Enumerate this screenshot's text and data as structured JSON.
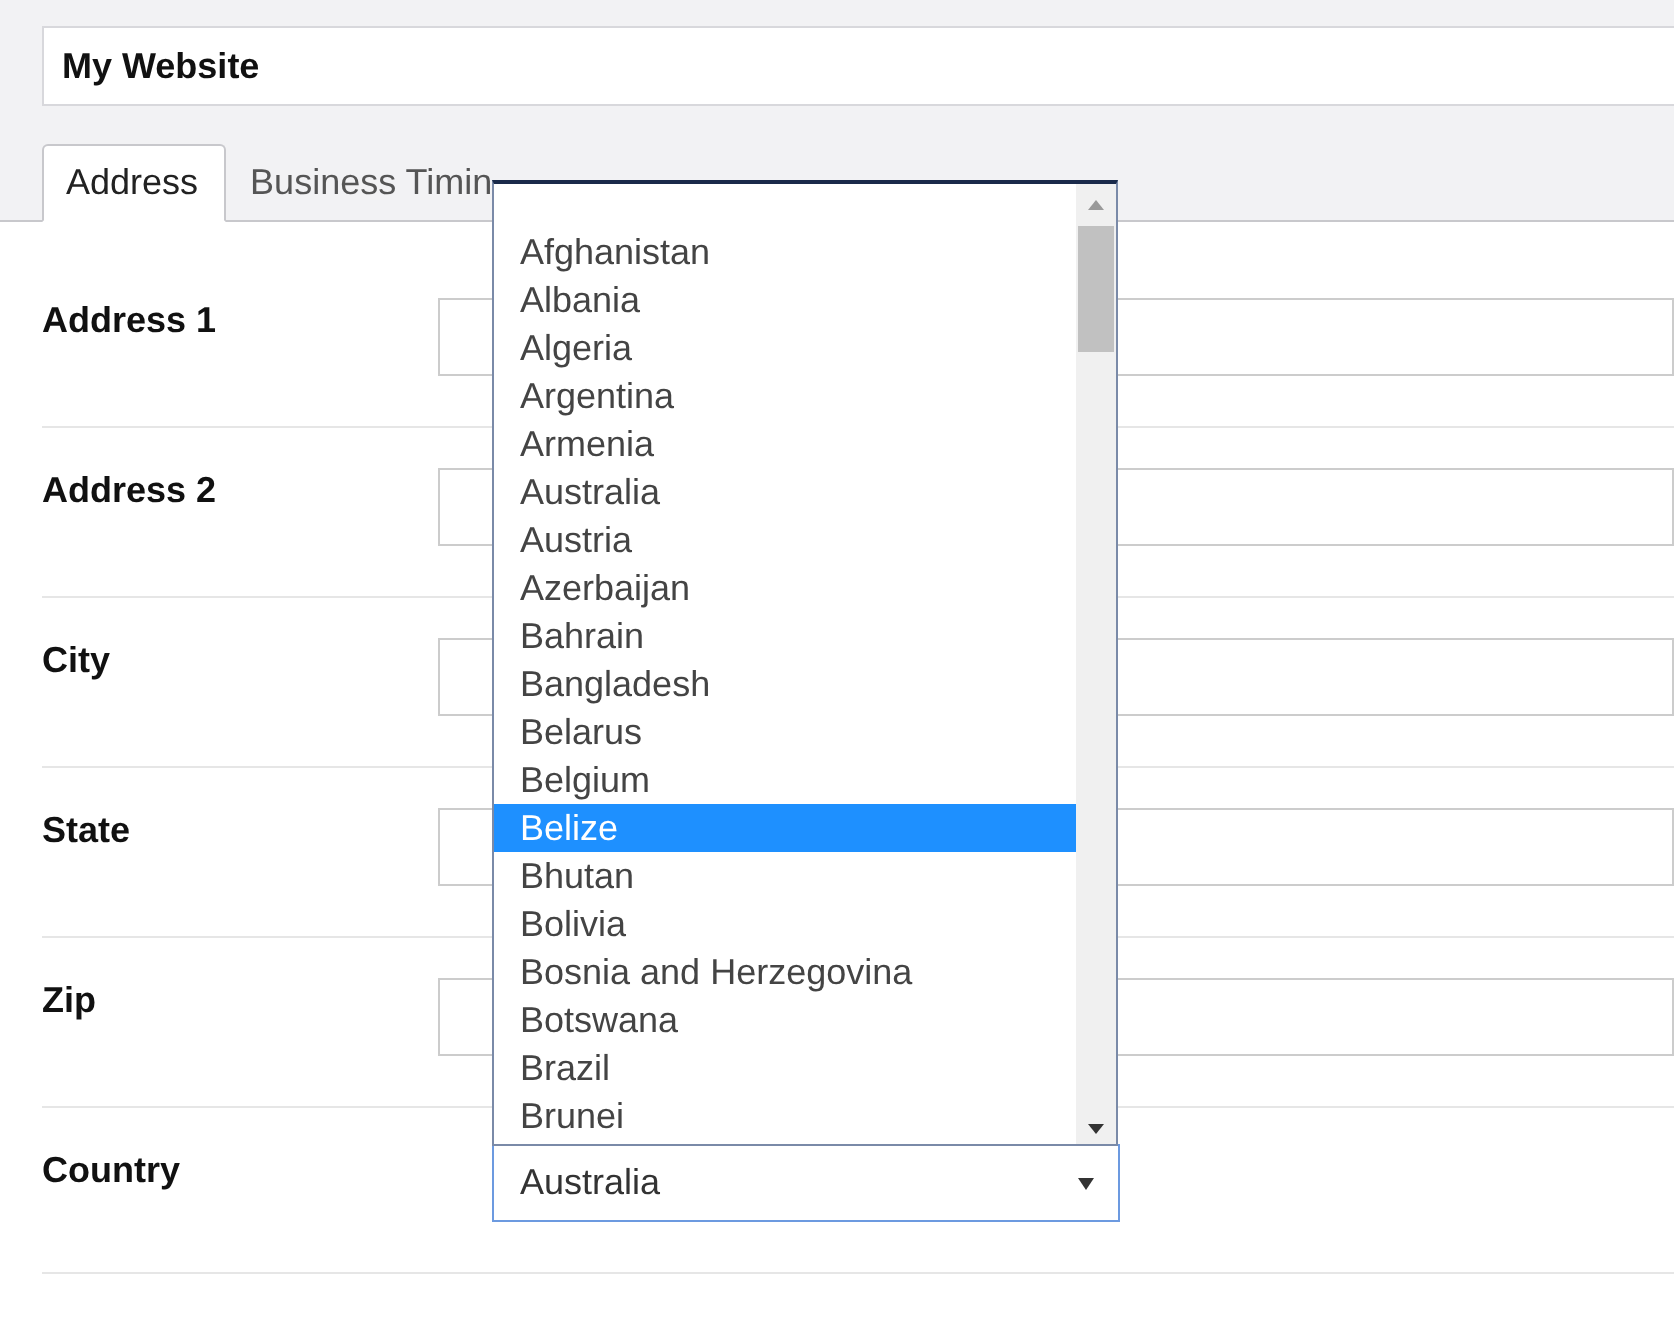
{
  "site_name": {
    "value": "My Website"
  },
  "tabs": [
    {
      "label": "Address",
      "selected": true
    },
    {
      "label": "Business Timin",
      "selected": false
    }
  ],
  "fields": [
    {
      "label": "Address 1",
      "kind": "text"
    },
    {
      "label": "Address 2",
      "kind": "text"
    },
    {
      "label": "City",
      "kind": "text"
    },
    {
      "label": "State",
      "kind": "text"
    },
    {
      "label": "Zip",
      "kind": "text"
    },
    {
      "label": "Country",
      "kind": "select",
      "value": "Australia"
    }
  ],
  "dropdown": {
    "options": [
      {
        "label": "Afghanistan",
        "selected": false
      },
      {
        "label": "Albania",
        "selected": false
      },
      {
        "label": "Algeria",
        "selected": false
      },
      {
        "label": "Argentina",
        "selected": false
      },
      {
        "label": "Armenia",
        "selected": false
      },
      {
        "label": "Australia",
        "selected": false
      },
      {
        "label": "Austria",
        "selected": false
      },
      {
        "label": "Azerbaijan",
        "selected": false
      },
      {
        "label": "Bahrain",
        "selected": false
      },
      {
        "label": "Bangladesh",
        "selected": false
      },
      {
        "label": "Belarus",
        "selected": false
      },
      {
        "label": "Belgium",
        "selected": false
      },
      {
        "label": "Belize",
        "selected": true
      },
      {
        "label": "Bhutan",
        "selected": false
      },
      {
        "label": "Bolivia",
        "selected": false
      },
      {
        "label": "Bosnia and Herzegovina",
        "selected": false
      },
      {
        "label": "Botswana",
        "selected": false
      },
      {
        "label": "Brazil",
        "selected": false
      },
      {
        "label": "Brunei",
        "selected": false
      }
    ]
  }
}
